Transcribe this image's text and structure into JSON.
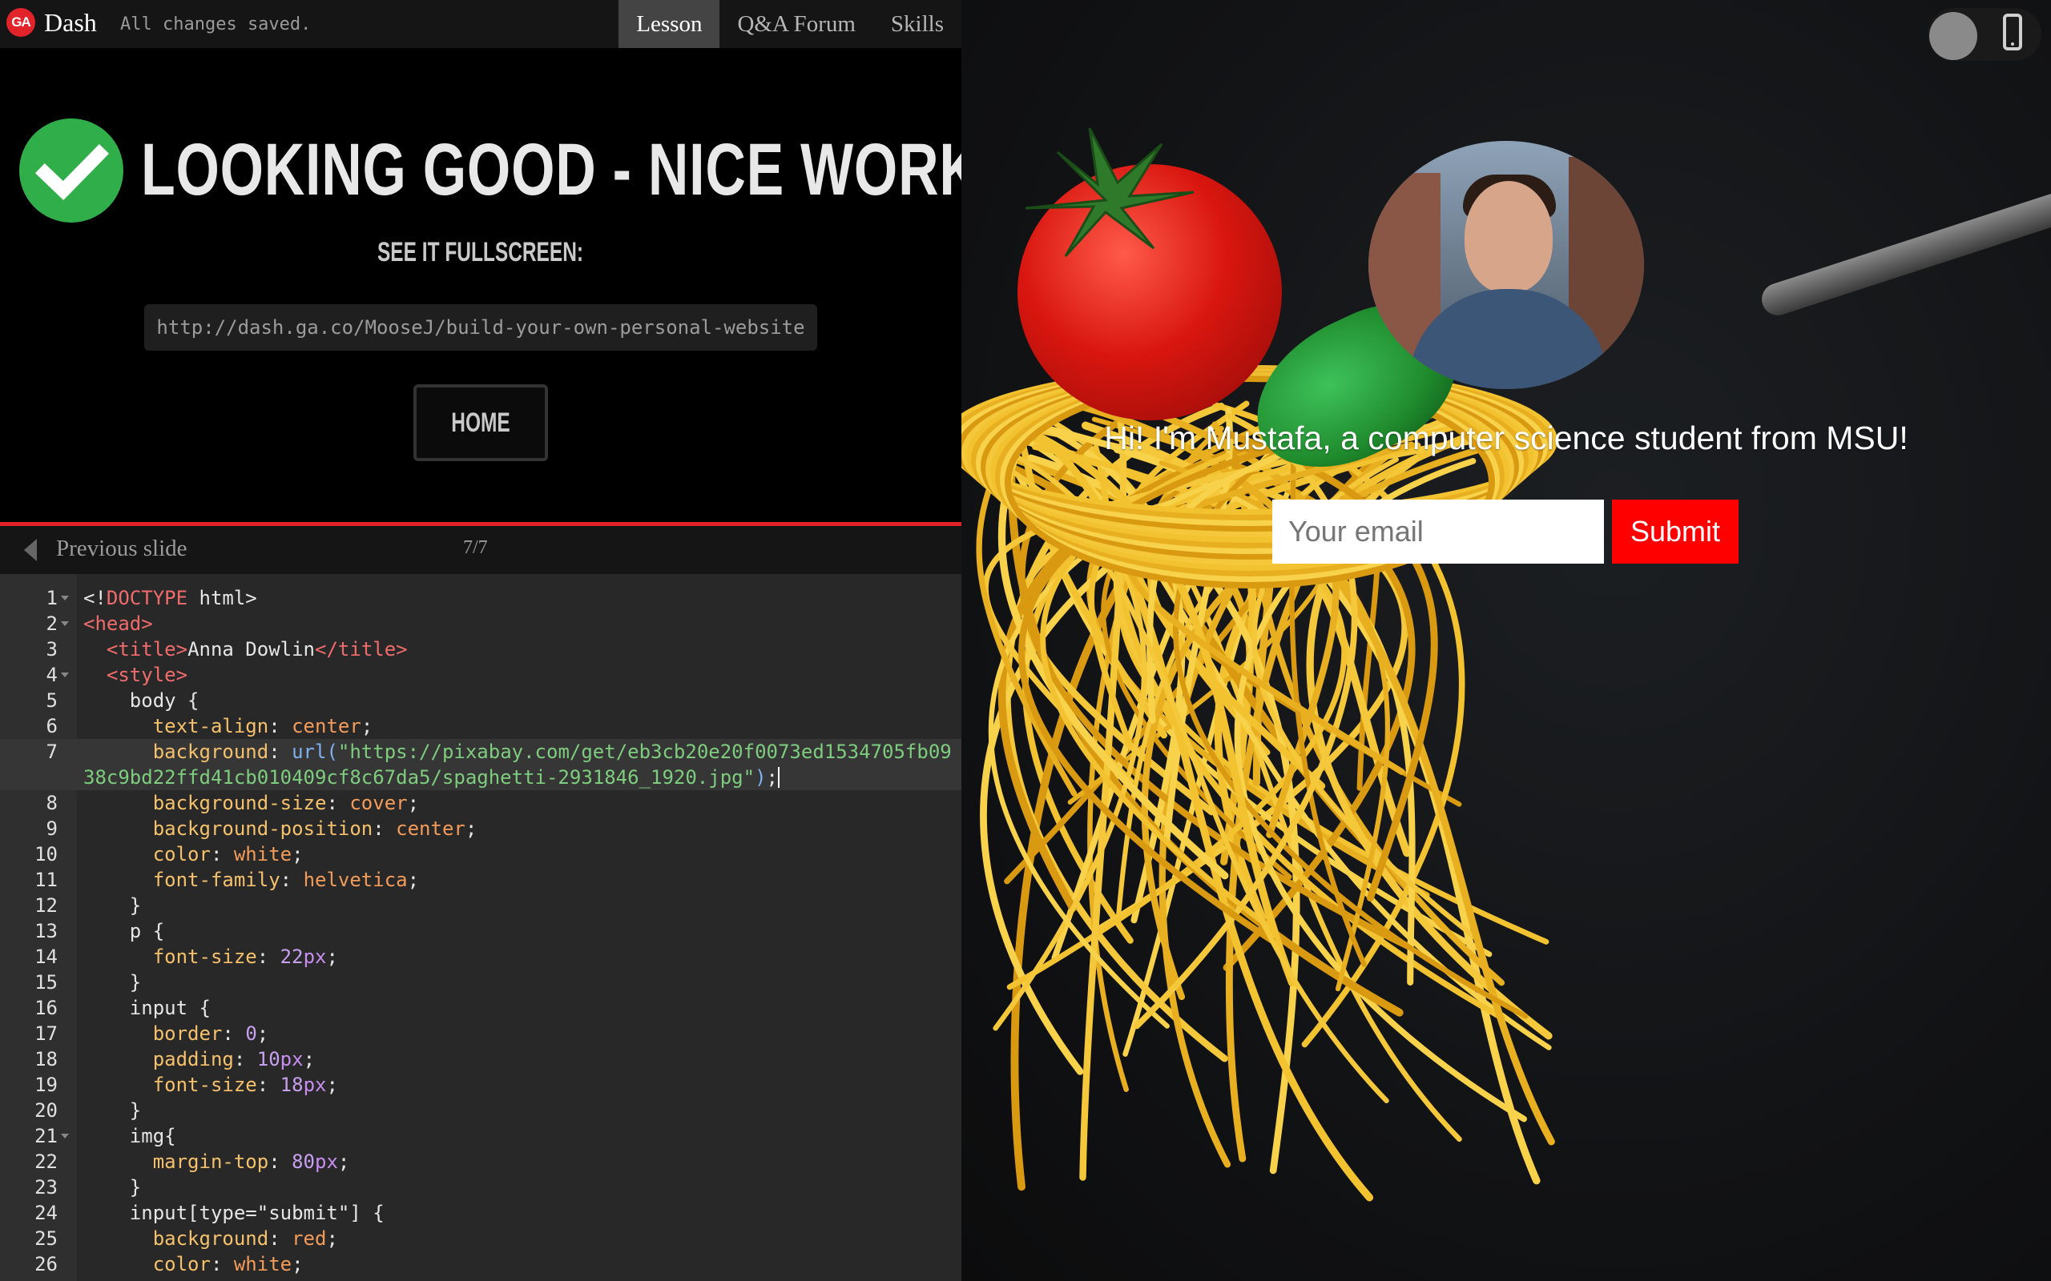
{
  "header": {
    "logo_text": "GA",
    "app_name": "Dash",
    "save_status": "All changes saved.",
    "tabs": [
      {
        "label": "Lesson",
        "active": true
      },
      {
        "label": "Q&A Forum",
        "active": false
      },
      {
        "label": "Skills",
        "active": false
      }
    ]
  },
  "lesson": {
    "headline": "LOOKING GOOD - NICE WORK!",
    "fullscreen_label": "SEE IT FULLSCREEN:",
    "fullscreen_url": "http://dash.ga.co/MooseJ/build-your-own-personal-website",
    "home_label": "HOME"
  },
  "slide_nav": {
    "prev_label": "Previous slide",
    "counter": "7/7"
  },
  "editor": {
    "lines": [
      {
        "n": "1",
        "fold": true,
        "html": "&lt;!<span class=\"tag\">DOCTYPE</span> html&gt;"
      },
      {
        "n": "2",
        "fold": true,
        "html": "<span class=\"tag\">&lt;head&gt;</span>"
      },
      {
        "n": "3",
        "fold": false,
        "html": "  <span class=\"tag\">&lt;title&gt;</span>Anna Dowlin<span class=\"tag\">&lt;/title&gt;</span>"
      },
      {
        "n": "4",
        "fold": true,
        "html": "  <span class=\"tag\">&lt;style&gt;</span>"
      },
      {
        "n": "5",
        "fold": false,
        "html": "    body {"
      },
      {
        "n": "6",
        "fold": false,
        "html": "      <span class=\"prop\">text-align</span>: <span class=\"val\">center</span>;"
      },
      {
        "n": "7",
        "fold": false,
        "html": "      <span class=\"prop\">background</span>: <span class=\"fn\">url(</span><span class=\"str\">\"https://pixabay.com/get/eb3cb20e20f0073ed1534705fb09</span>"
      },
      {
        "n": "",
        "fold": false,
        "html": "<span class=\"str\">38c9bd22ffd41cb010409cf8c67da5/spaghetti-2931846_1920.jpg\"</span><span class=\"fn\">)</span>;<span id=\"cursor\"></span>"
      },
      {
        "n": "8",
        "fold": false,
        "html": "      <span class=\"prop\">background-size</span>: <span class=\"val\">cover</span>;"
      },
      {
        "n": "9",
        "fold": false,
        "html": "      <span class=\"prop\">background-position</span>: <span class=\"val\">center</span>;"
      },
      {
        "n": "10",
        "fold": false,
        "html": "      <span class=\"prop\">color</span>: <span class=\"val\">white</span>;"
      },
      {
        "n": "11",
        "fold": false,
        "html": "      <span class=\"prop\">font-family</span>: <span class=\"val\">helvetica</span>;"
      },
      {
        "n": "12",
        "fold": false,
        "html": "    }"
      },
      {
        "n": "13",
        "fold": false,
        "html": "    p {"
      },
      {
        "n": "14",
        "fold": false,
        "html": "      <span class=\"prop\">font-size</span>: <span class=\"num\">22</span><span class=\"unit\">px</span>;"
      },
      {
        "n": "15",
        "fold": false,
        "html": "    }"
      },
      {
        "n": "16",
        "fold": false,
        "html": "    input {"
      },
      {
        "n": "17",
        "fold": false,
        "html": "      <span class=\"prop\">border</span>: <span class=\"num\">0</span>;"
      },
      {
        "n": "18",
        "fold": false,
        "html": "      <span class=\"prop\">padding</span>: <span class=\"num\">10</span><span class=\"unit\">px</span>;"
      },
      {
        "n": "19",
        "fold": false,
        "html": "      <span class=\"prop\">font-size</span>: <span class=\"num\">18</span><span class=\"unit\">px</span>;"
      },
      {
        "n": "20",
        "fold": false,
        "html": "    }"
      },
      {
        "n": "21",
        "fold": true,
        "html": "    img{"
      },
      {
        "n": "22",
        "fold": false,
        "html": "      <span class=\"prop\">margin-top</span>: <span class=\"num\">80</span><span class=\"unit\">px</span>;"
      },
      {
        "n": "23",
        "fold": false,
        "html": "    }"
      },
      {
        "n": "24",
        "fold": false,
        "html": "    input[type=\"submit\"] {"
      },
      {
        "n": "25",
        "fold": false,
        "html": "      <span class=\"prop\">background</span>: <span class=\"val\">red</span>;"
      },
      {
        "n": "26",
        "fold": false,
        "html": "      <span class=\"prop\">color</span>: <span class=\"val\">white</span>;"
      }
    ]
  },
  "preview": {
    "tagline": "Hi! I'm Mustafa, a computer science student from MSU!",
    "email_placeholder": "Your email",
    "submit_label": "Submit"
  },
  "colors": {
    "accent_red": "#e2232a",
    "success_green": "#2fae4a",
    "submit_red": "#ff0000"
  },
  "icons": {
    "logo": "ga-logo-icon",
    "success": "checkmark-circle-icon",
    "prev": "chevron-left-icon",
    "device": "mobile-phone-icon"
  }
}
